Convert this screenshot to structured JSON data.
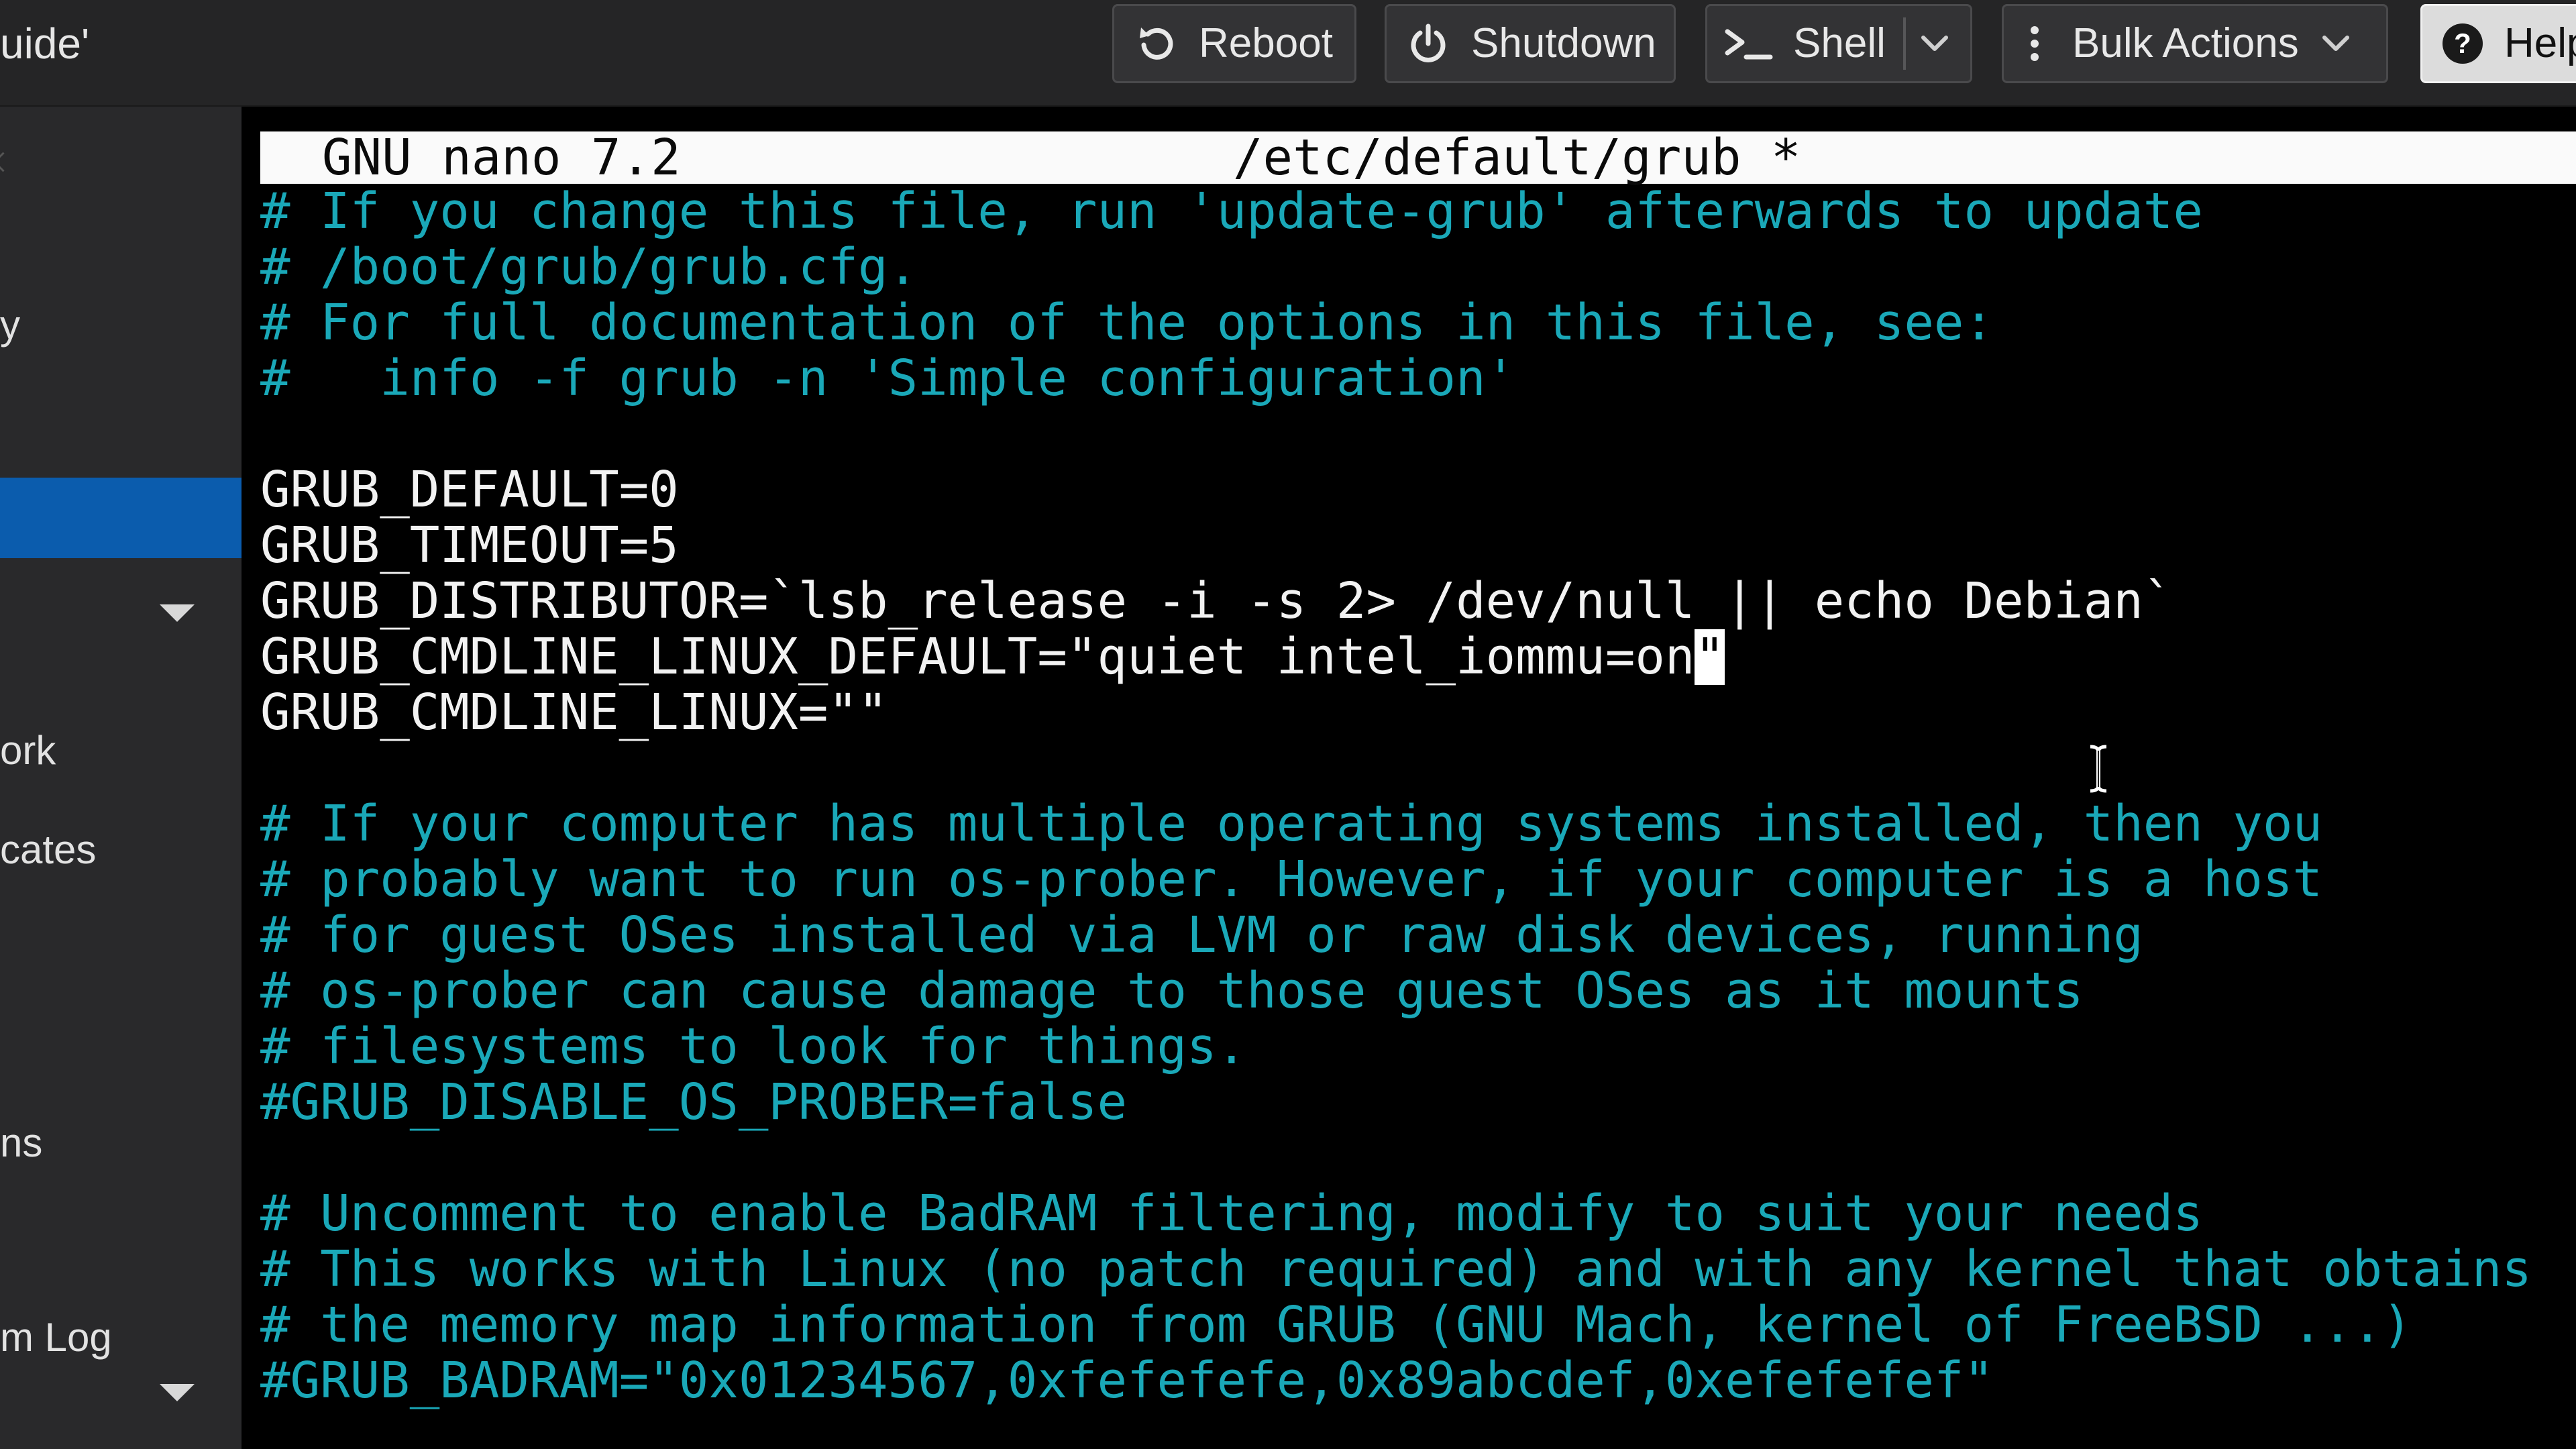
{
  "window": {
    "title_fragment": "uide'"
  },
  "toolbar": {
    "reboot_label": "Reboot",
    "shutdown_label": "Shutdown",
    "shell_label": "Shell",
    "bulk_actions_label": "Bulk Actions",
    "help_label": "Help"
  },
  "sidebar": {
    "items": [
      {
        "label": "y"
      },
      {
        "label": ""
      },
      {
        "label": ""
      },
      {
        "label": "ork"
      },
      {
        "label": "cates"
      },
      {
        "label": "ns"
      },
      {
        "label": "m Log"
      }
    ],
    "selected_index": 2
  },
  "nano": {
    "app_version": "GNU nano 7.2",
    "file_path": "/etc/default/grub *",
    "lines": [
      {
        "text": "# If you change this file, run 'update-grub' afterwards to update",
        "kind": "comment"
      },
      {
        "text": "# /boot/grub/grub.cfg.",
        "kind": "comment"
      },
      {
        "text": "# For full documentation of the options in this file, see:",
        "kind": "comment"
      },
      {
        "text": "#   info -f grub -n 'Simple configuration'",
        "kind": "comment"
      },
      {
        "text": "",
        "kind": "blank"
      },
      {
        "text": "GRUB_DEFAULT=0",
        "kind": "setting"
      },
      {
        "text": "GRUB_TIMEOUT=5",
        "kind": "setting"
      },
      {
        "text": "GRUB_DISTRIBUTOR=`lsb_release -i -s 2> /dev/null || echo Debian`",
        "kind": "setting"
      },
      {
        "text_before_cursor": "GRUB_CMDLINE_LINUX_DEFAULT=\"quiet intel_iommu=on",
        "cursor_char": "\"",
        "kind": "setting"
      },
      {
        "text": "GRUB_CMDLINE_LINUX=\"\"",
        "kind": "setting"
      },
      {
        "text": "",
        "kind": "blank"
      },
      {
        "text": "# If your computer has multiple operating systems installed, then you",
        "kind": "comment"
      },
      {
        "text": "# probably want to run os-prober. However, if your computer is a host",
        "kind": "comment"
      },
      {
        "text": "# for guest OSes installed via LVM or raw disk devices, running",
        "kind": "comment"
      },
      {
        "text": "# os-prober can cause damage to those guest OSes as it mounts",
        "kind": "comment"
      },
      {
        "text": "# filesystems to look for things.",
        "kind": "comment"
      },
      {
        "text": "#GRUB_DISABLE_OS_PROBER=false",
        "kind": "comment"
      },
      {
        "text": "",
        "kind": "blank"
      },
      {
        "text": "# Uncomment to enable BadRAM filtering, modify to suit your needs",
        "kind": "comment"
      },
      {
        "text": "# This works with Linux (no patch required) and with any kernel that obtains",
        "kind": "comment"
      },
      {
        "text": "# the memory map information from GRUB (GNU Mach, kernel of FreeBSD ...)",
        "kind": "comment"
      },
      {
        "text": "#GRUB_BADRAM=\"0x01234567,0xfefefefe,0x89abcdef,0xefefefef\"",
        "kind": "comment"
      }
    ]
  },
  "colors": {
    "toolbar_bg": "#252526",
    "sidebar_bg": "#29292b",
    "selected_item": "#0b5cad",
    "comment_text": "#1aa8b8",
    "setting_text": "#f2f2f2",
    "terminal_bg": "#000000"
  },
  "icons": {
    "reboot": "rotate-ccw-icon",
    "shutdown": "power-icon",
    "shell": "terminal-prompt-icon",
    "bulk_actions": "vertical-ellipsis-icon",
    "help": "question-circle-icon"
  }
}
